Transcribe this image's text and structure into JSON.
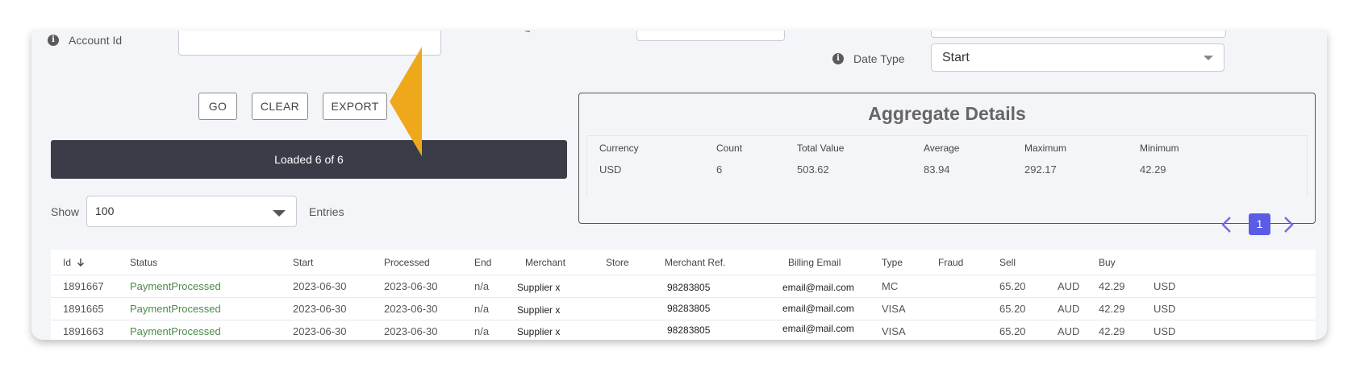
{
  "filters": {
    "account_id_label": "Account Id",
    "account_id_value": "",
    "date_type_label": "Date Type",
    "date_type_value": "Start"
  },
  "buttons": {
    "go": "GO",
    "clear": "CLEAR",
    "export": "EXPORT"
  },
  "status": {
    "loaded_text": "Loaded 6 of 6"
  },
  "aggregate": {
    "title": "Aggregate Details",
    "headers": [
      "Currency",
      "Count",
      "Total Value",
      "Average",
      "Maximum",
      "Minimum"
    ],
    "values": [
      "USD",
      "6",
      "503.62",
      "83.94",
      "292.17",
      "42.29"
    ]
  },
  "paging": {
    "show_label": "Show",
    "entries_label": "Entries",
    "page_size": "100",
    "current_page": "1",
    "prev_icon": "chevron-left-icon",
    "next_icon": "chevron-right-icon"
  },
  "table": {
    "headers": [
      "Id",
      "Status",
      "Start",
      "Processed",
      "End",
      "Merchant",
      "Store",
      "Merchant Ref.",
      "Billing Email",
      "Type",
      "Fraud",
      "Sell",
      "",
      "Buy",
      ""
    ],
    "sort_icon": "arrow-down-icon",
    "rows": [
      [
        "1891667",
        "PaymentProcessed",
        "2023-06-30",
        "2023-06-30",
        "n/a",
        "Supplier x",
        "",
        "98283805",
        "email@mail.com",
        "MC",
        "",
        "65.20",
        "AUD",
        "42.29",
        "USD"
      ],
      [
        "1891665",
        "PaymentProcessed",
        "2023-06-30",
        "2023-06-30",
        "n/a",
        "Supplier x",
        "",
        "98283805",
        "email@mail.com",
        "VISA",
        "",
        "65.20",
        "AUD",
        "42.29",
        "USD"
      ],
      [
        "1891663",
        "PaymentProcessed",
        "2023-06-30",
        "2023-06-30",
        "n/a",
        "Supplier x",
        "",
        "98283805",
        "email@mail.com",
        "VISA",
        "",
        "65.20",
        "AUD",
        "42.29",
        "USD"
      ]
    ]
  },
  "colors": {
    "accent": "#5a5ce6",
    "status_green": "#4b8a4b",
    "callout": "#f0a81b",
    "loaded_bar": "#3a3d47"
  }
}
